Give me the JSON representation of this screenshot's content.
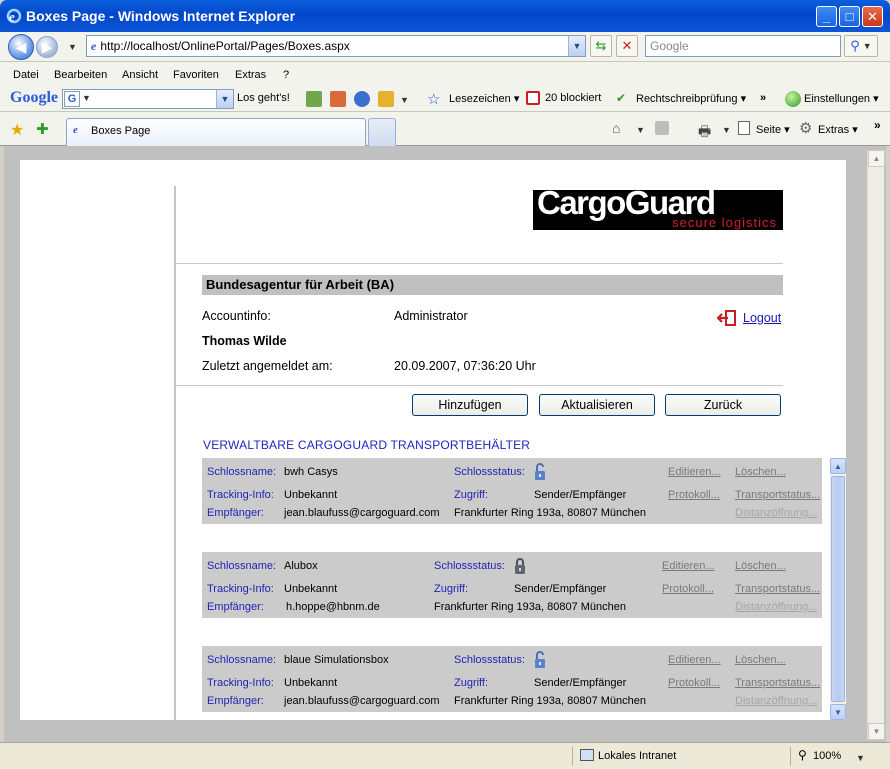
{
  "window": {
    "title": "Boxes Page - Windows Internet Explorer"
  },
  "address": {
    "url": "http://localhost/OnlinePortal/Pages/Boxes.aspx",
    "search_placeholder": "Google"
  },
  "menu": [
    "Datei",
    "Bearbeiten",
    "Ansicht",
    "Favoriten",
    "Extras",
    "?"
  ],
  "google_toolbar": {
    "logo": "Google",
    "go_label": "Los geht's!",
    "bookmarks": "Lesezeichen",
    "blocked": "20 blockiert",
    "spellcheck": "Rechtschreibprüfung",
    "more": "»",
    "settings": "Einstellungen"
  },
  "tabs": {
    "active_label": "Boxes Page"
  },
  "command_bar": {
    "page": "Seite",
    "extras": "Extras"
  },
  "page": {
    "logo_main": "CargoGuard",
    "logo_sub": "secure logistics",
    "agency": "Bundesagentur für Arbeit (BA)",
    "account_label": "Accountinfo:",
    "account_value": "Administrator",
    "user_name": "Thomas Wilde",
    "last_login_label": "Zuletzt angemeldet am:",
    "last_login_value": "20.09.2007, 07:36:20 Uhr",
    "logout": "Logout",
    "buttons": {
      "add": "Hinzufügen",
      "refresh": "Aktualisieren",
      "back": "Zurück"
    },
    "section_title": "VERWALTBARE CARGOGUARD TRANSPORTBEHÄLTER",
    "labels": {
      "lock_name": "Schlossname:",
      "lock_status": "Schlossstatus:",
      "tracking": "Tracking-Info:",
      "access": "Zugriff:",
      "receiver": "Empfänger:"
    },
    "actions": {
      "edit": "Editieren...",
      "delete": "Löschen...",
      "log": "Protokoll...",
      "transport": "Transportstatus...",
      "remote_open": "Distanzöffnung..."
    },
    "boxes": [
      {
        "name": "bwh Casys",
        "lock": "open",
        "tracking": "Unbekannt",
        "access": "Sender/Empfänger",
        "receiver": "jean.blaufuss@cargoguard.com",
        "address": "Frankfurter Ring 193a, 80807 München"
      },
      {
        "name": "Alubox",
        "lock": "closed",
        "tracking": "Unbekannt",
        "access": "Sender/Empfänger",
        "receiver": "h.hoppe@hbnm.de",
        "address": "Frankfurter Ring 193a, 80807 München"
      },
      {
        "name": "blaue Simulationsbox",
        "lock": "open",
        "tracking": "Unbekannt",
        "access": "Sender/Empfänger",
        "receiver": "jean.blaufuss@cargoguard.com",
        "address": "Frankfurter Ring 193a, 80807 München"
      }
    ]
  },
  "status": {
    "zone": "Lokales Intranet",
    "zoom": "100%"
  },
  "colors": {
    "titlebar": "#0447c9",
    "link": "#1a1ab0",
    "label_blue": "#2323b5",
    "logo_red": "#d0202a"
  }
}
